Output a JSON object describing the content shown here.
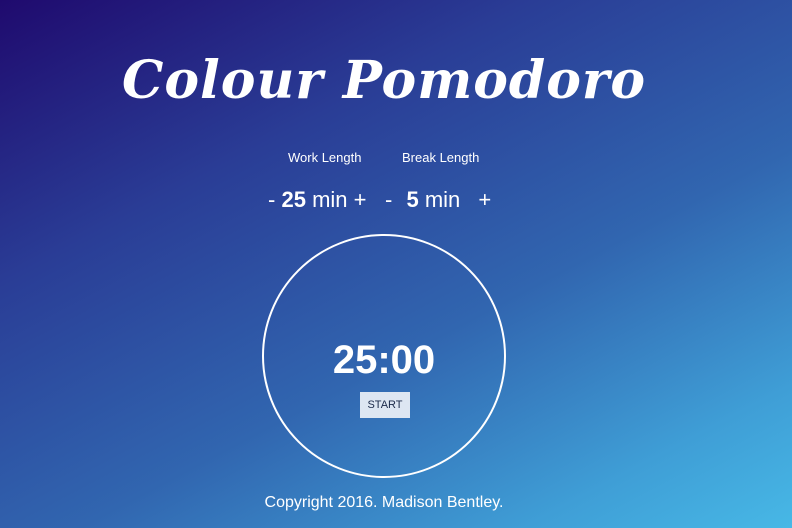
{
  "app": {
    "title": "Colour Pomodoro"
  },
  "settings": {
    "work": {
      "label": "Work Length",
      "decrement": "-",
      "value": "25",
      "unit": "min",
      "increment": "+"
    },
    "break": {
      "label": "Break Length",
      "decrement": "-",
      "value": "5",
      "unit": "min",
      "increment": "+"
    }
  },
  "timer": {
    "display": "25:00",
    "start_label": "START"
  },
  "footer": {
    "text": "Copyright 2016. Madison Bentley."
  },
  "colors": {
    "gradient_start": "#1f0a6e",
    "gradient_end": "#47b8e6",
    "text": "#ffffff",
    "button_bg": "#dde6f2"
  }
}
